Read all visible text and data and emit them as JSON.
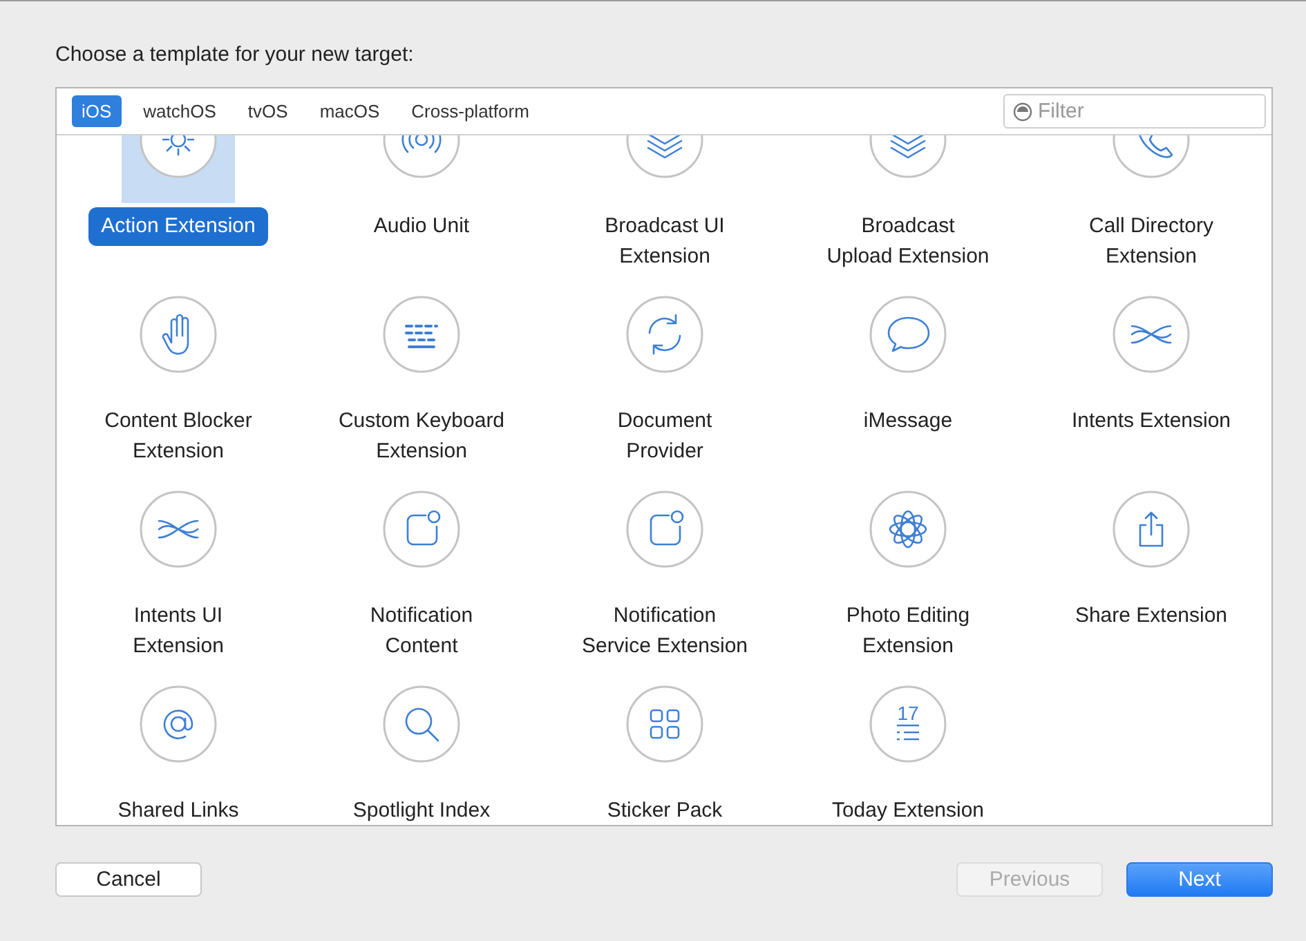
{
  "heading": "Choose a template for your new target:",
  "tabs": [
    {
      "label": "iOS",
      "selected": true
    },
    {
      "label": "watchOS",
      "selected": false
    },
    {
      "label": "tvOS",
      "selected": false
    },
    {
      "label": "macOS",
      "selected": false
    },
    {
      "label": "Cross-platform",
      "selected": false
    }
  ],
  "filter": {
    "placeholder": "Filter"
  },
  "templates": [
    {
      "label": "Action Extension",
      "selected": true
    },
    {
      "label": "Audio Unit",
      "selected": false
    },
    {
      "label": "Broadcast UI\nExtension",
      "selected": false
    },
    {
      "label": "Broadcast\nUpload Extension",
      "selected": false
    },
    {
      "label": "Call Directory\nExtension",
      "selected": false
    },
    {
      "label": "Content Blocker\nExtension",
      "selected": false
    },
    {
      "label": "Custom Keyboard\nExtension",
      "selected": false
    },
    {
      "label": "Document\nProvider",
      "selected": false
    },
    {
      "label": "iMessage",
      "selected": false
    },
    {
      "label": "Intents Extension",
      "selected": false
    },
    {
      "label": "Intents UI\nExtension",
      "selected": false
    },
    {
      "label": "Notification\nContent",
      "selected": false
    },
    {
      "label": "Notification\nService Extension",
      "selected": false
    },
    {
      "label": "Photo Editing\nExtension",
      "selected": false
    },
    {
      "label": "Share Extension",
      "selected": false
    },
    {
      "label": "Shared Links",
      "selected": false
    },
    {
      "label": "Spotlight Index",
      "selected": false
    },
    {
      "label": "Sticker Pack",
      "selected": false
    },
    {
      "label": "Today Extension",
      "selected": false
    }
  ],
  "buttons": {
    "cancel": {
      "label": "Cancel"
    },
    "previous": {
      "label": "Previous",
      "disabled": true
    },
    "next": {
      "label": "Next",
      "disabled": false
    }
  },
  "calendar_icon_day": "17"
}
